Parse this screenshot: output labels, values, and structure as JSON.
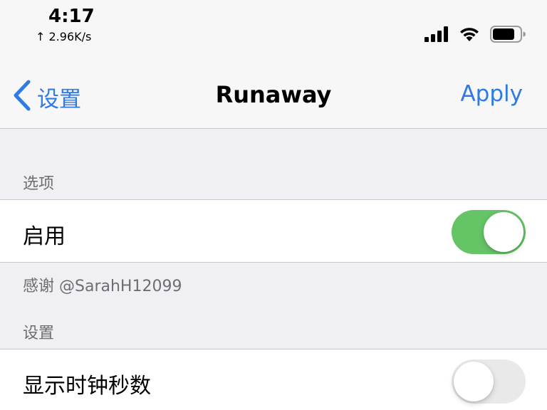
{
  "status_bar": {
    "time": "4:17",
    "network_speed": "↑ 2.96K/s",
    "signal_icon": "cellular-signal-icon",
    "wifi_icon": "wifi-icon",
    "battery_icon": "battery-icon"
  },
  "nav_bar": {
    "back_label": "设置",
    "back_icon": "chevron-left-icon",
    "title": "Runaway",
    "apply_label": "Apply"
  },
  "sections": {
    "options": {
      "header": "选项",
      "rows": [
        {
          "label": "启用",
          "toggle": true
        }
      ],
      "footer": "感谢 @SarahH12099"
    },
    "settings": {
      "header": "设置",
      "rows": [
        {
          "label": "显示时钟秒数",
          "toggle": false
        }
      ]
    }
  },
  "colors": {
    "accent": "#2f7ae5",
    "toggle_on": "#65c466",
    "toggle_off": "#e9e9ea",
    "background": "#efeff4",
    "secondary_text": "#6d6d72"
  }
}
